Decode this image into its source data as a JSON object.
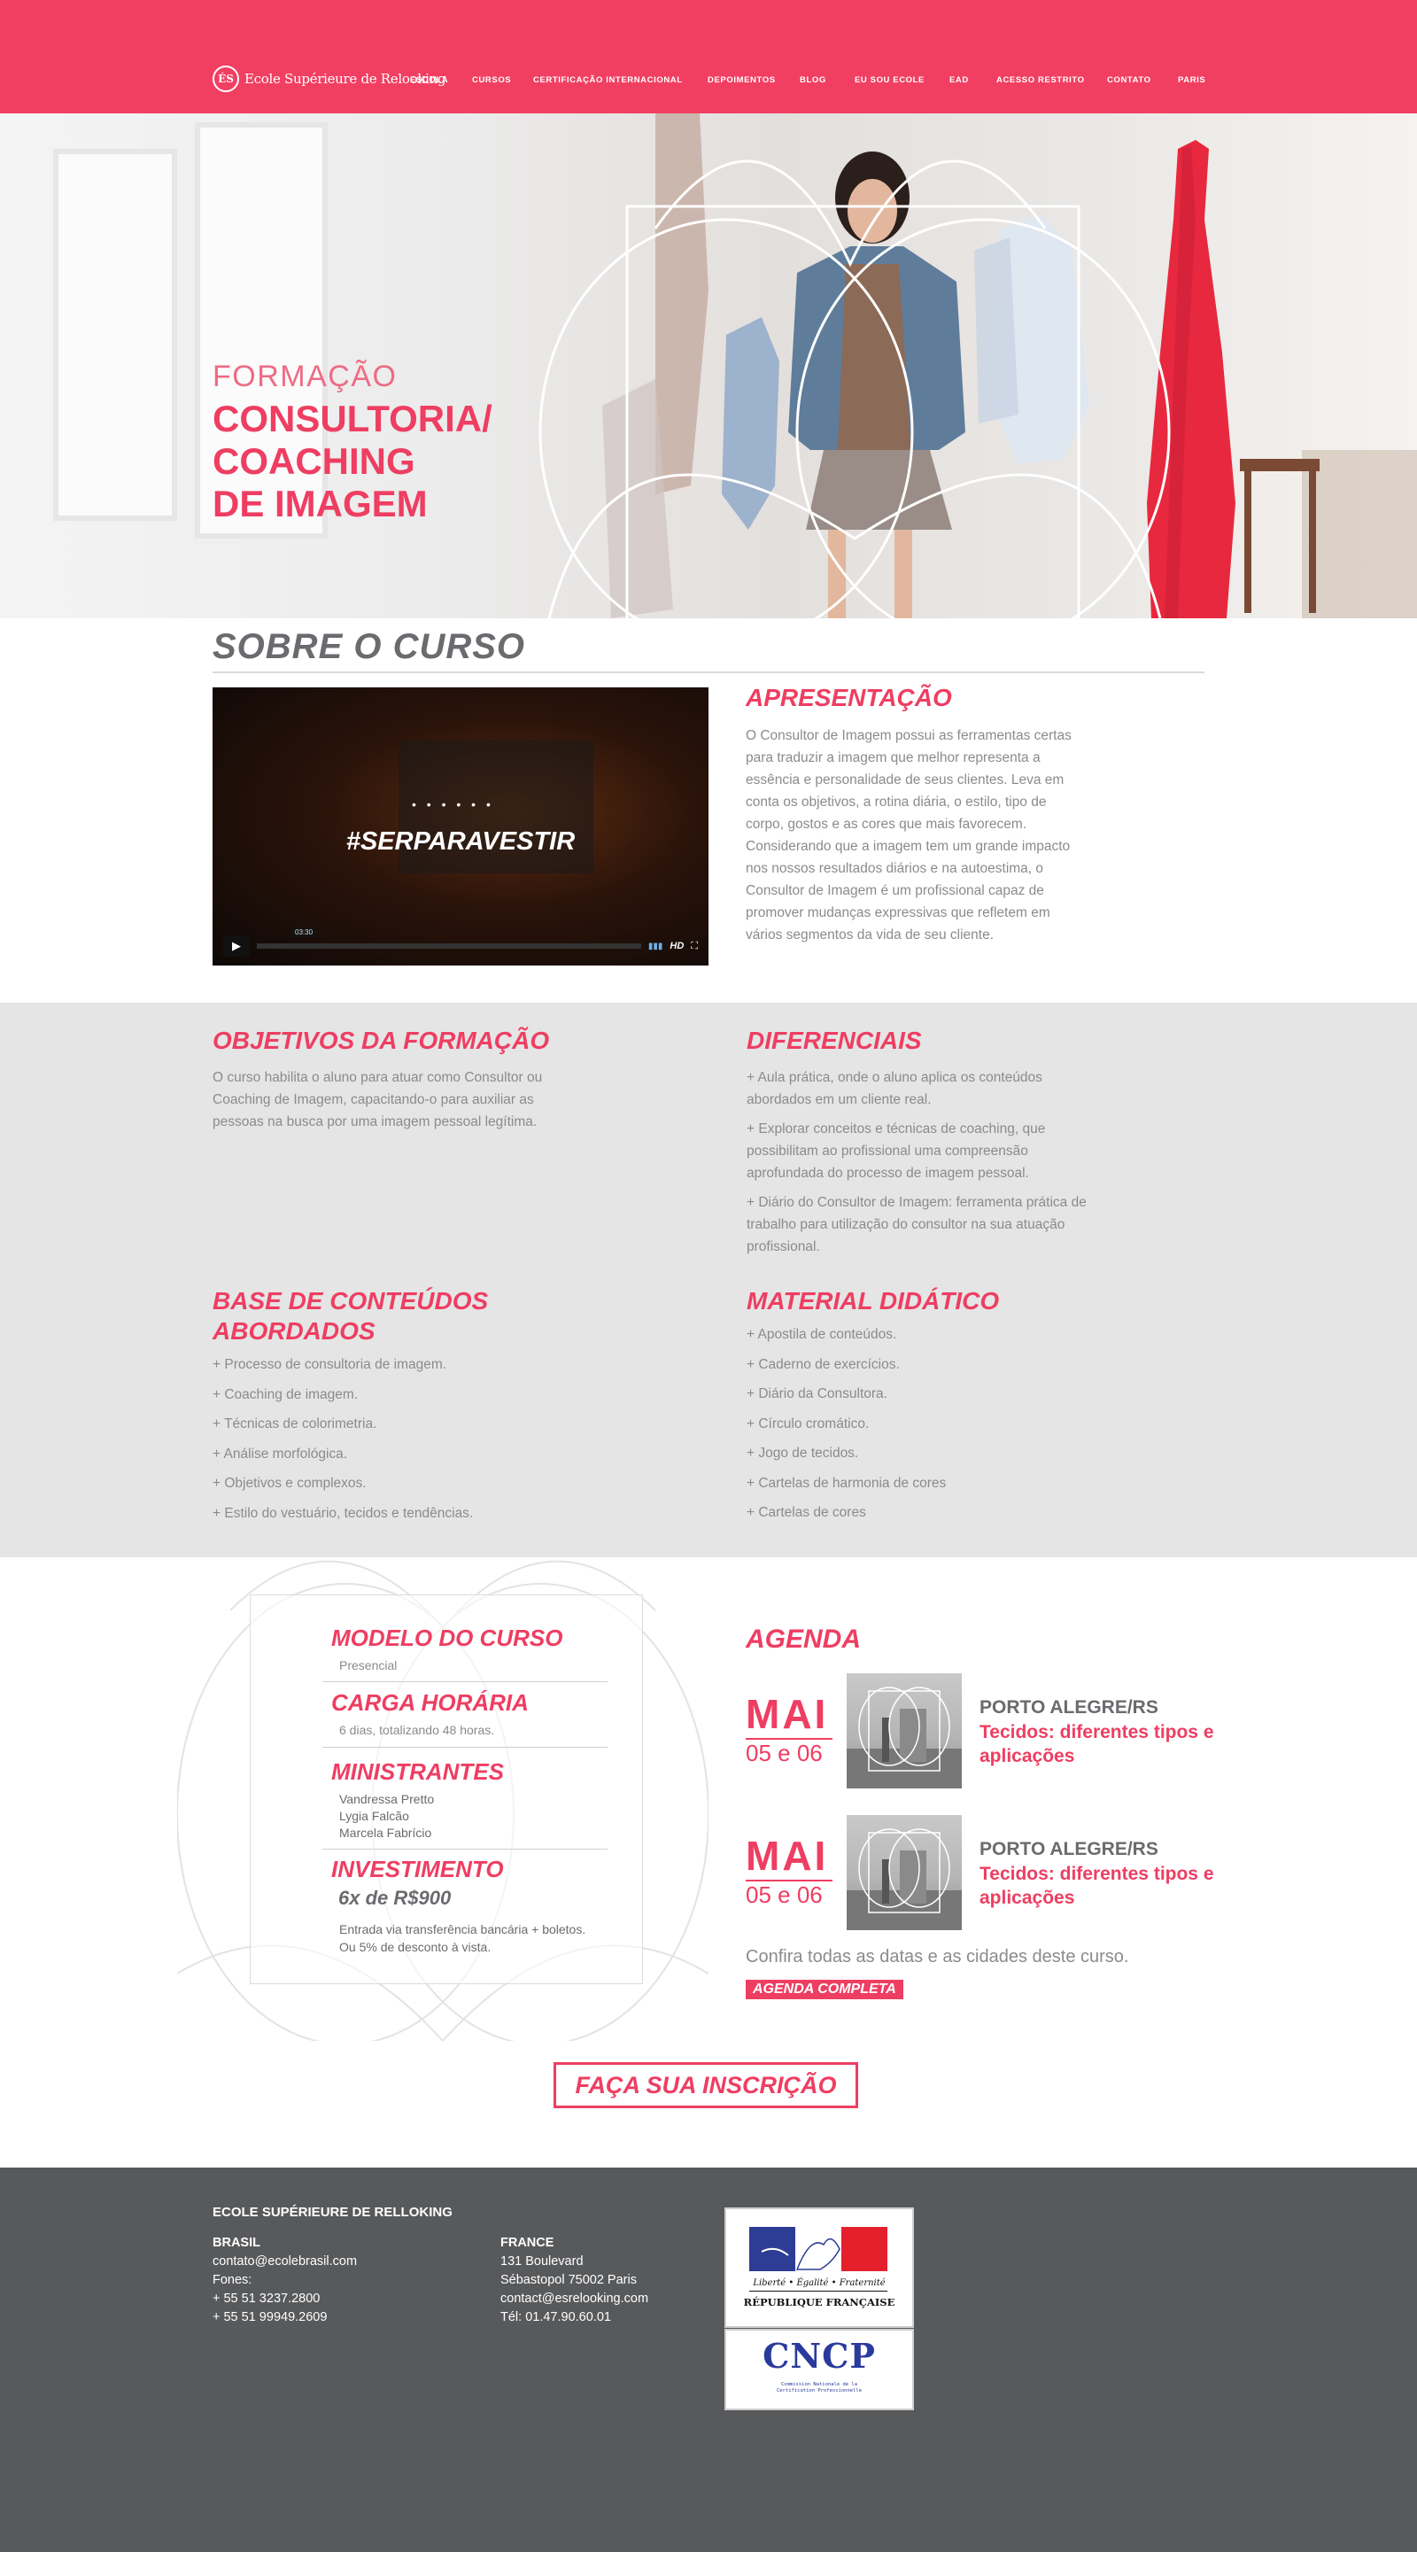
{
  "header": {
    "logo_mark": "ÉS",
    "logo_text": "Ecole Supérieure de Relooking",
    "nav": [
      "ESCOLA",
      "CURSOS",
      "CERTIFICAÇÃO INTERNACIONAL",
      "DEPOIMENTOS",
      "BLOG",
      "EU SOU ECOLE",
      "EAD",
      "ACESSO RESTRITO",
      "CONTATO",
      "PARIS"
    ]
  },
  "hero": {
    "subtitle": "FORMAÇÃO",
    "title_lines": [
      "CONSULTORIA/",
      "COACHING",
      "DE IMAGEM"
    ]
  },
  "about": {
    "title": "SOBRE O CURSO",
    "video": {
      "tag": "#SERPARAVESTIR",
      "dots": "• • •   • • •",
      "time": "03:30",
      "hd": "HD"
    },
    "presentation_title": "APRESENTAÇÃO",
    "presentation_text": "O Consultor de Imagem possui as ferramentas certas para traduzir a imagem que melhor representa a essência e personalidade de seus clientes. Leva em conta os objetivos, a rotina diária, o estilo, tipo de corpo, gostos e as cores que mais favorecem. Considerando que a imagem tem um grande impacto nos nossos resultados diários e na autoestima, o Consultor de Imagem é um profissional capaz de promover mudanças expressivas que refletem em vários segmentos da vida de seu cliente."
  },
  "objectives": {
    "title": "OBJETIVOS DA FORMAÇÃO",
    "text": "O curso habilita o aluno para atuar como Consultor ou Coaching de Imagem, capacitando-o para auxiliar as pessoas na busca por uma imagem pessoal legítima."
  },
  "differentials": {
    "title": "DIFERENCIAIS",
    "items": [
      "+ Aula prática, onde o aluno aplica os conteúdos abordados em um cliente real.",
      "+ Explorar conceitos e técnicas de coaching, que possibilitam ao profissional uma compreensão aprofundada do processo de imagem pessoal.",
      "+ Diário do Consultor de Imagem: ferramenta prática de trabalho para utilização do consultor na sua atuação profissional."
    ]
  },
  "contents": {
    "title_lines": [
      "BASE DE CONTEÚDOS",
      "ABORDADOS"
    ],
    "items": [
      "+ Processo de consultoria de imagem.",
      "+ Coaching de imagem.",
      "+ Técnicas de colorimetria.",
      "+ Análise morfológica.",
      "+ Objetivos e complexos.",
      "+ Estilo do vestuário, tecidos e tendências."
    ]
  },
  "material": {
    "title": "MATERIAL DIDÁTICO",
    "items": [
      "+ Apostila de conteúdos.",
      "+ Caderno de exercícios.",
      "+ Diário da Consultora.",
      "+ Círculo cromático.",
      "+ Jogo de tecidos.",
      "+ Cartelas de harmonia de cores",
      "+ Cartelas de cores"
    ]
  },
  "course": {
    "model_title": "MODELO DO CURSO",
    "model_value": "Presencial",
    "load_title": "CARGA HORÁRIA",
    "load_value": "6 dias, totalizando 48 horas.",
    "ministers_title": "MINISTRANTES",
    "ministers": [
      "Vandressa Pretto",
      "Lygia Falcão",
      "Marcela Fabrício"
    ],
    "investment_title": "INVESTIMENTO",
    "price": "6x de R$900",
    "price_note_1": "Entrada via transferência bancária + boletos.",
    "price_note_2": "Ou 5% de desconto à vista."
  },
  "agenda": {
    "title": "AGENDA",
    "events": [
      {
        "month": "MAI",
        "days": "05 e 06",
        "city": "PORTO ALEGRE/RS",
        "topic": "Tecidos: diferentes tipos e aplicações"
      },
      {
        "month": "MAI",
        "days": "05 e 06",
        "city": "PORTO ALEGRE/RS",
        "topic": "Tecidos: diferentes tipos e aplicações"
      }
    ],
    "note": "Confira todas as datas e as cidades deste curso.",
    "button": "AGENDA COMPLETA"
  },
  "cta": "FAÇA SUA INSCRIÇÃO",
  "footer": {
    "title": "ECOLE SUPÉRIEURE DE RELLOKING",
    "brasil": {
      "heading": "BRASIL",
      "lines": [
        "contato@ecolebrasil.com",
        "Fones:",
        "+ 55 51 3237.2800",
        "+ 55 51 99949.2609"
      ]
    },
    "france": {
      "heading": "FRANCE",
      "lines": [
        "131 Boulevard",
        "Sébastopol 75002 Paris",
        "contact@esrelooking.com",
        "Tél: 01.47.90.60.01"
      ]
    },
    "rf_motto": "Liberté • Égalité • Fraternité",
    "rf_name": "RÉPUBLIQUE FRANÇAISE",
    "cncp_logo": "CNCP",
    "cncp_text": "Commission Nationale de la Certification Professionnelle"
  },
  "colors": {
    "accent": "#ee3e62",
    "header": "#f13f62",
    "grey_section": "#e5e5e5",
    "footer": "#58595b",
    "text": "#6d6e71"
  }
}
